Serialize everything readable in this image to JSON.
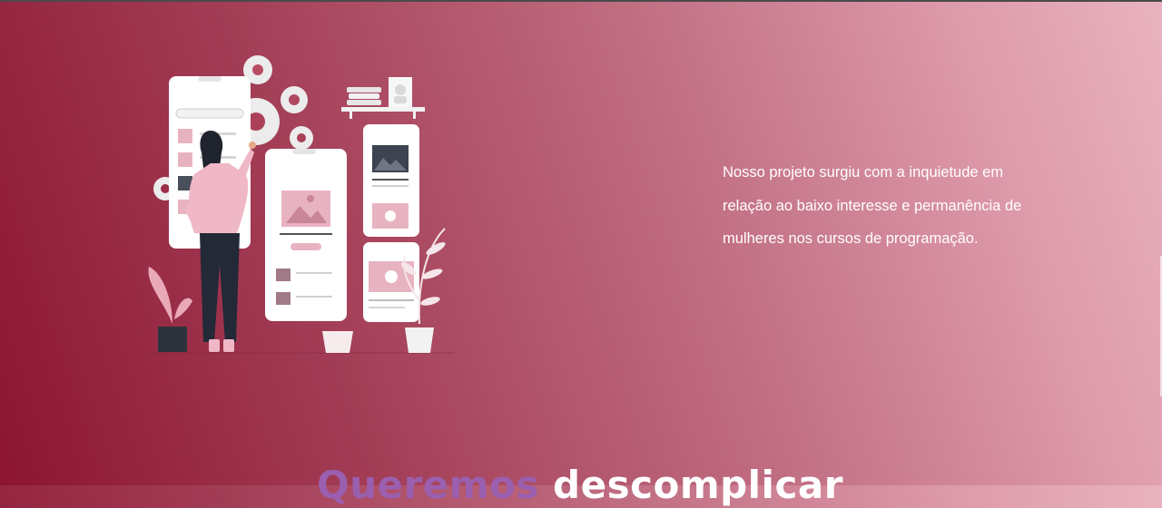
{
  "colors": {
    "background_start": "#8c1530",
    "background_end": "#e9b3bf",
    "text": "#ffffff",
    "heading_highlight": "#9a5fae"
  },
  "hero": {
    "illustration": "woman-designing-app-screens-illustration",
    "intro_text": "Nosso projeto surgiu com a inquietude em relação ao baixo interesse e permanência de mulheres nos cursos de programação."
  },
  "next_section": {
    "heading_highlight": "Queremos",
    "heading_rest": "descomplicar"
  }
}
